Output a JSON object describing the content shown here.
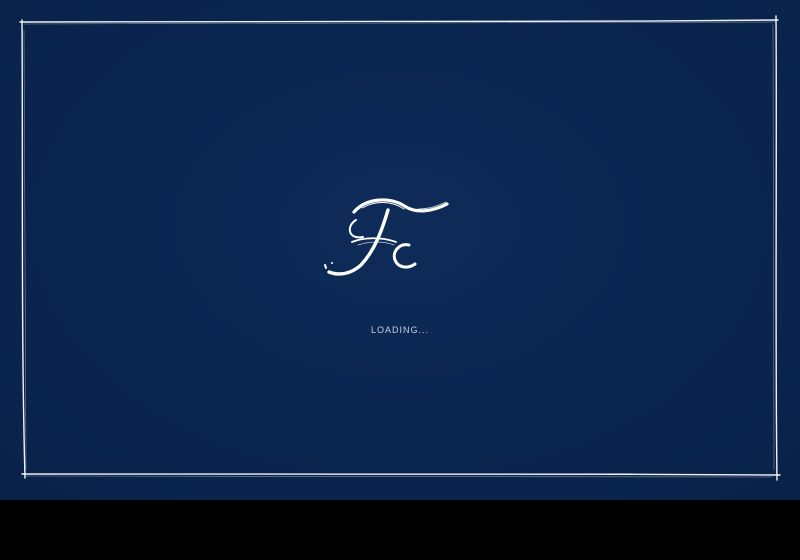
{
  "screen": {
    "status_text": "LOADING...",
    "logo": {
      "letters": "Fc",
      "type": "handwritten monogram"
    }
  },
  "colors": {
    "background": "#0a2651",
    "frame_line": "#ffffff",
    "logo": "#ffffff",
    "status_text": "#c7d0de",
    "bottom_bar": "#000000"
  }
}
